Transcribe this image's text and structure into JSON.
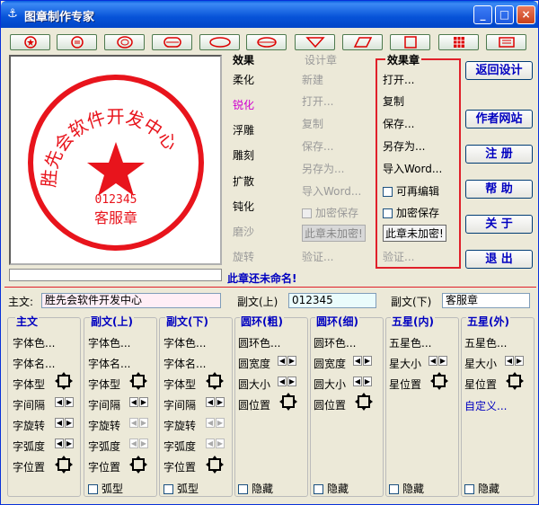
{
  "window": {
    "title": "图章制作专家",
    "minimize": "_",
    "maximize": "□",
    "close": "×"
  },
  "toolbar": {
    "icons": [
      "star-stamp-icon",
      "circle-stamp-icon",
      "oval-stamp-icon",
      "rounded-rect-stamp-icon",
      "ellipse-stamp-icon",
      "lined-ellipse-stamp-icon",
      "triangle-stamp-icon",
      "parallelogram-stamp-icon",
      "square-stamp-icon",
      "grid-stamp-icon",
      "document-stamp-icon"
    ]
  },
  "stamp": {
    "ring_text": "胜先会软件开发中心",
    "number": "012345",
    "bottom": "客服章",
    "color": "#e8141c"
  },
  "effects": {
    "heading": "效果",
    "items": [
      "柔化",
      "锐化",
      "浮雕",
      "雕刻",
      "扩散",
      "钝化",
      "磨沙",
      "旋转"
    ]
  },
  "design": {
    "heading": "设计章",
    "items": [
      "新建",
      "打开...",
      "复制",
      "保存...",
      "另存为...",
      "导入Word...",
      "加密保存",
      "此章未加密!",
      "验证..."
    ]
  },
  "stamp_menu": {
    "heading": "效果章",
    "items": [
      "打开...",
      "复制",
      "保存...",
      "另存为...",
      "导入Word...",
      "可再编辑",
      "加密保存",
      "此章未加密!",
      "验证..."
    ]
  },
  "side_buttons": [
    "返回设计",
    "作者网站",
    "注 册",
    "帮 助",
    "关 于",
    "退 出"
  ],
  "status": {
    "unnamed": "此章还未命名!"
  },
  "fields": {
    "main_label": "主文:",
    "main_value": "胜先会软件开发中心",
    "upper_label": "副文(上)",
    "upper_value": "012345",
    "lower_label": "副文(下)",
    "lower_value": "客服章"
  },
  "groups": [
    {
      "title": "主文",
      "items": [
        "字体色...",
        "字体名...",
        "字体型",
        "字间隔",
        "字旋转",
        "字弧度",
        "字位置"
      ]
    },
    {
      "title": "副文(上)",
      "items": [
        "字体色...",
        "字体名...",
        "字体型",
        "字间隔",
        "字旋转",
        "字弧度",
        "字位置"
      ],
      "check": "弧型"
    },
    {
      "title": "副文(下)",
      "items": [
        "字体色...",
        "字体名...",
        "字体型",
        "字间隔",
        "字旋转",
        "字弧度",
        "字位置"
      ],
      "check": "弧型"
    },
    {
      "title": "圆环(粗)",
      "items": [
        "圆环色...",
        "圆宽度",
        "圆大小",
        "圆位置"
      ],
      "check": "隐藏"
    },
    {
      "title": "圆环(细)",
      "items": [
        "圆环色...",
        "圆宽度",
        "圆大小",
        "圆位置"
      ],
      "check": "隐藏"
    },
    {
      "title": "五星(内)",
      "items": [
        "五星色...",
        "星大小",
        "星位置"
      ],
      "check": "隐藏"
    },
    {
      "title": "五星(外)",
      "items": [
        "五星色...",
        "星大小",
        "星位置",
        "自定义..."
      ],
      "check": "隐藏"
    }
  ]
}
